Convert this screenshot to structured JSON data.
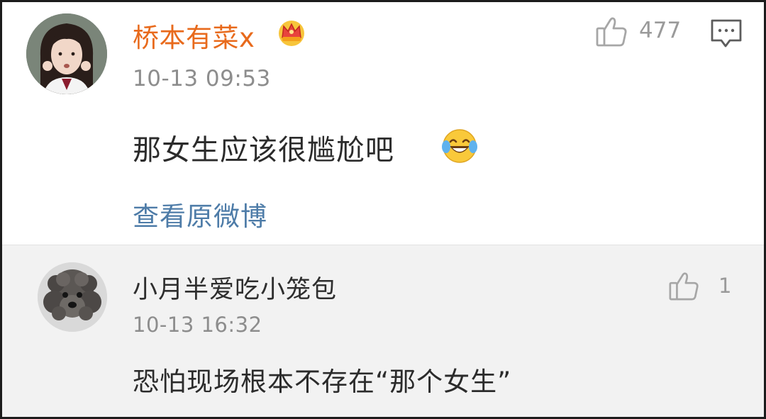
{
  "comment": {
    "username": "桥本有菜x",
    "badge_icon": "crown-icon",
    "timestamp": "10-13 09:53",
    "like_icon": "thumbs-up-icon",
    "like_count": "477",
    "reply_icon": "comment-reply-icon",
    "text": "那女生应该很尴尬吧",
    "emoji": "laughing-crying-emoji",
    "view_original_label": "查看原微博"
  },
  "reply": {
    "username": "小月半爱吃小笼包",
    "timestamp": "10-13 16:32",
    "like_icon": "thumbs-up-icon",
    "like_count": "1",
    "text": "恐怕现场根本不存在“那个女生”"
  },
  "colors": {
    "username_accent": "#e86a1c",
    "link": "#4e7ca8",
    "secondary_text": "#8d8d8d",
    "reply_background": "#f2f2f2"
  }
}
